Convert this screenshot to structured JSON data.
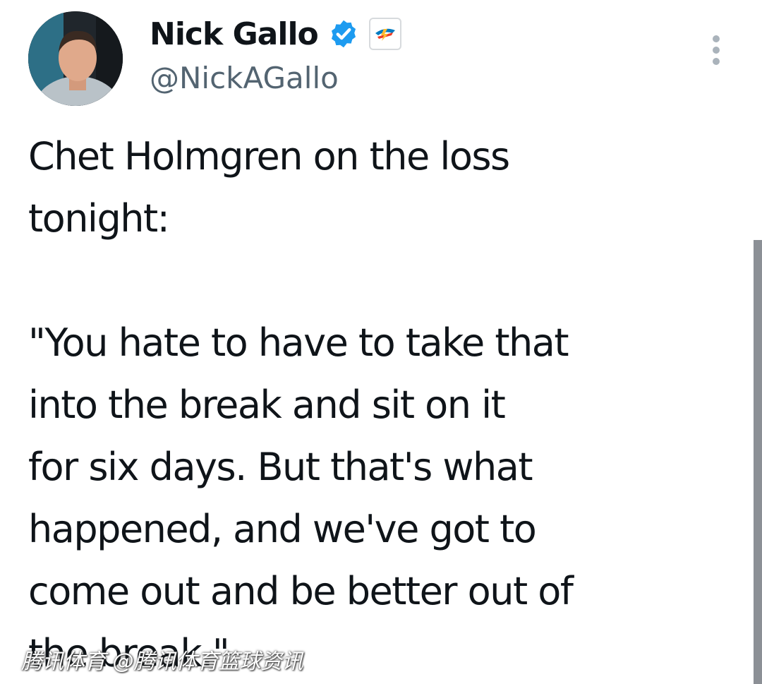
{
  "user": {
    "display_name": "Nick Gallo",
    "handle": "@NickAGallo",
    "verified_color": "#1d9bf0"
  },
  "tweet": {
    "text": "Chet Holmgren on the loss\ntonight:\n\n\"You hate to have to take that\ninto the break and sit on it\nfor six days. But that's what\nhappened, and we've got to\ncome out and be better out of\nthe break.\""
  },
  "icons": {
    "verified": "verified-badge-icon",
    "affiliate": "okc-thunder-logo-icon",
    "more": "more-options-icon"
  },
  "watermark": "腾讯体育 @腾讯体育篮球资讯"
}
